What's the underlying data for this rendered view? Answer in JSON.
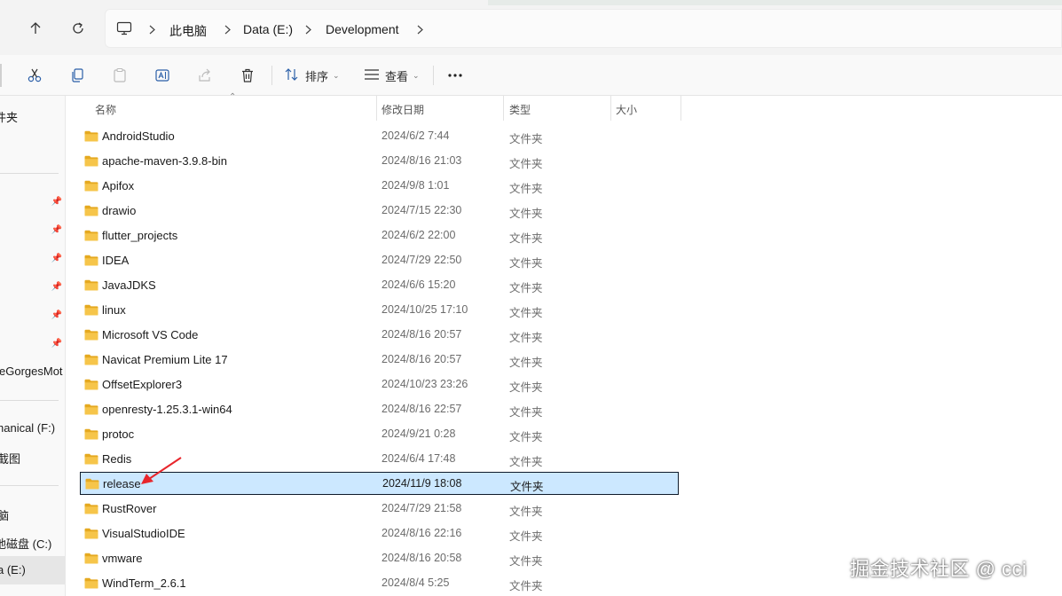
{
  "address_bar": {
    "crumbs": [
      "此电脑",
      "Data (E:)",
      "Development"
    ]
  },
  "toolbar": {
    "sort_label": "排序",
    "view_label": "查看"
  },
  "sidebar": {
    "items": [
      "件夹",
      "eGorgesMot",
      "hanical (F:)",
      "截图",
      "脑",
      "地磁盘 (C:)",
      "a (E:)"
    ]
  },
  "columns": {
    "name": "名称",
    "modified": "修改日期",
    "type": "类型",
    "size": "大小"
  },
  "files": [
    {
      "name": "AndroidStudio",
      "modified": "2024/6/2 7:44",
      "type": "文件夹"
    },
    {
      "name": "apache-maven-3.9.8-bin",
      "modified": "2024/8/16 21:03",
      "type": "文件夹"
    },
    {
      "name": "Apifox",
      "modified": "2024/9/8 1:01",
      "type": "文件夹"
    },
    {
      "name": "drawio",
      "modified": "2024/7/15 22:30",
      "type": "文件夹"
    },
    {
      "name": "flutter_projects",
      "modified": "2024/6/2 22:00",
      "type": "文件夹"
    },
    {
      "name": "IDEA",
      "modified": "2024/7/29 22:50",
      "type": "文件夹"
    },
    {
      "name": "JavaJDKS",
      "modified": "2024/6/6 15:20",
      "type": "文件夹"
    },
    {
      "name": "linux",
      "modified": "2024/10/25 17:10",
      "type": "文件夹"
    },
    {
      "name": "Microsoft VS Code",
      "modified": "2024/8/16 20:57",
      "type": "文件夹"
    },
    {
      "name": "Navicat Premium Lite 17",
      "modified": "2024/8/16 20:57",
      "type": "文件夹"
    },
    {
      "name": "OffsetExplorer3",
      "modified": "2024/10/23 23:26",
      "type": "文件夹"
    },
    {
      "name": "openresty-1.25.3.1-win64",
      "modified": "2024/8/16 22:57",
      "type": "文件夹"
    },
    {
      "name": "protoc",
      "modified": "2024/9/21 0:28",
      "type": "文件夹"
    },
    {
      "name": "Redis",
      "modified": "2024/6/4 17:48",
      "type": "文件夹"
    },
    {
      "name": "release",
      "modified": "2024/11/9 18:08",
      "type": "文件夹",
      "selected": true
    },
    {
      "name": "RustRover",
      "modified": "2024/7/29 21:58",
      "type": "文件夹"
    },
    {
      "name": "VisualStudioIDE",
      "modified": "2024/8/16 22:16",
      "type": "文件夹"
    },
    {
      "name": "vmware",
      "modified": "2024/8/16 20:58",
      "type": "文件夹"
    },
    {
      "name": "WindTerm_2.6.1",
      "modified": "2024/8/4 5:25",
      "type": "文件夹"
    }
  ],
  "watermark": "掘金技术社区 @ cci",
  "colors": {
    "folder": "#f6c54a",
    "selection": "#cce8ff",
    "annotation_arrow": "#e8262c"
  }
}
